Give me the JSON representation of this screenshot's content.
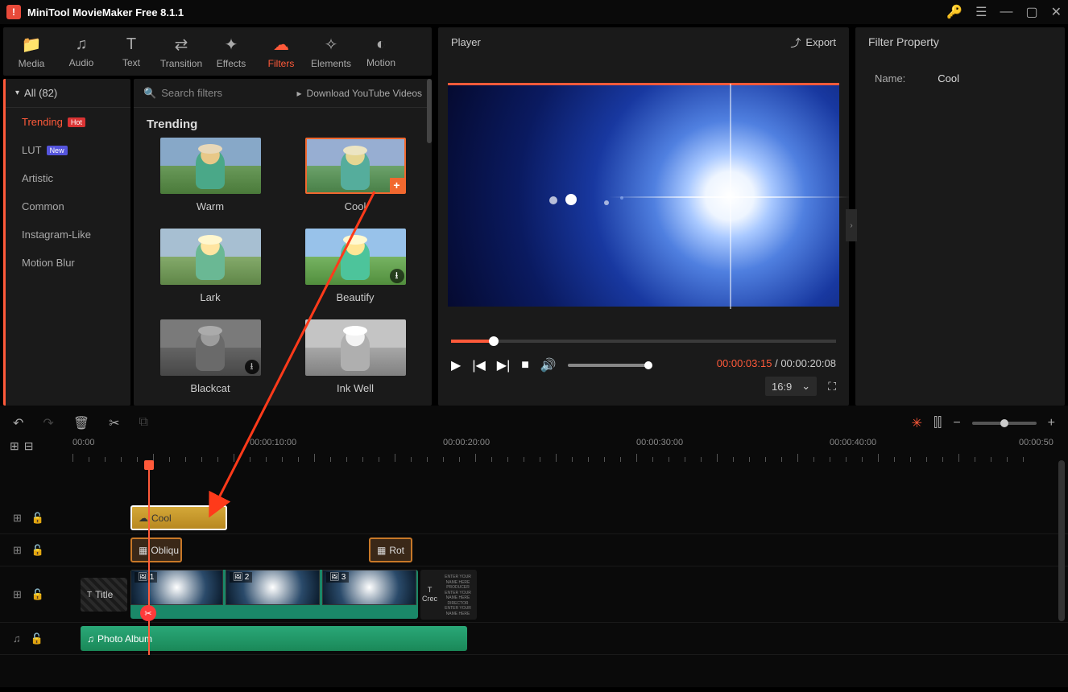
{
  "app": {
    "title": "MiniTool MovieMaker Free 8.1.1"
  },
  "toolbar": {
    "items": [
      {
        "label": "Media",
        "icon": "folder"
      },
      {
        "label": "Audio",
        "icon": "music"
      },
      {
        "label": "Text",
        "icon": "text"
      },
      {
        "label": "Transition",
        "icon": "swap"
      },
      {
        "label": "Effects",
        "icon": "sparkle"
      },
      {
        "label": "Filters",
        "icon": "cloud",
        "active": true
      },
      {
        "label": "Elements",
        "icon": "star"
      },
      {
        "label": "Motion",
        "icon": "motion"
      }
    ]
  },
  "sidebar": {
    "header": "All (82)",
    "items": [
      {
        "label": "Trending",
        "badge": "Hot",
        "badgeClass": "hot",
        "active": true
      },
      {
        "label": "LUT",
        "badge": "New",
        "badgeClass": "new"
      },
      {
        "label": "Artistic"
      },
      {
        "label": "Common"
      },
      {
        "label": "Instagram-Like"
      },
      {
        "label": "Motion Blur"
      }
    ]
  },
  "filters": {
    "search_placeholder": "Search filters",
    "download_link": "Download YouTube Videos",
    "section": "Trending",
    "items": [
      {
        "label": "Warm"
      },
      {
        "label": "Cool",
        "selected": true,
        "add": true
      },
      {
        "label": "Lark"
      },
      {
        "label": "Beautify",
        "download": true
      },
      {
        "label": "Blackcat",
        "download": true
      },
      {
        "label": "Ink Well"
      }
    ]
  },
  "player": {
    "title": "Player",
    "export": "Export",
    "time_current": "00:00:03:15",
    "time_total": "00:00:20:08",
    "aspect": "16:9"
  },
  "property": {
    "title": "Filter Property",
    "name_label": "Name:",
    "name_value": "Cool"
  },
  "timeline": {
    "marks": [
      "00:00",
      "00:00:10:00",
      "00:00:20:00",
      "00:00:30:00",
      "00:00:40:00",
      "00:00:50"
    ],
    "clips": {
      "filter": "Cool",
      "trans1": "Obliqu",
      "trans2": "Rot",
      "title": "Title",
      "video_labels": [
        "1",
        "2",
        "3"
      ],
      "credits": "Crec",
      "credits_lines": [
        "ENTER YOUR NAME HERE",
        "PRODUCER",
        "ENTER YOUR NAME HERE",
        "DIRECTOR",
        "ENTER YOUR NAME HERE"
      ],
      "audio": "Photo Album"
    }
  }
}
